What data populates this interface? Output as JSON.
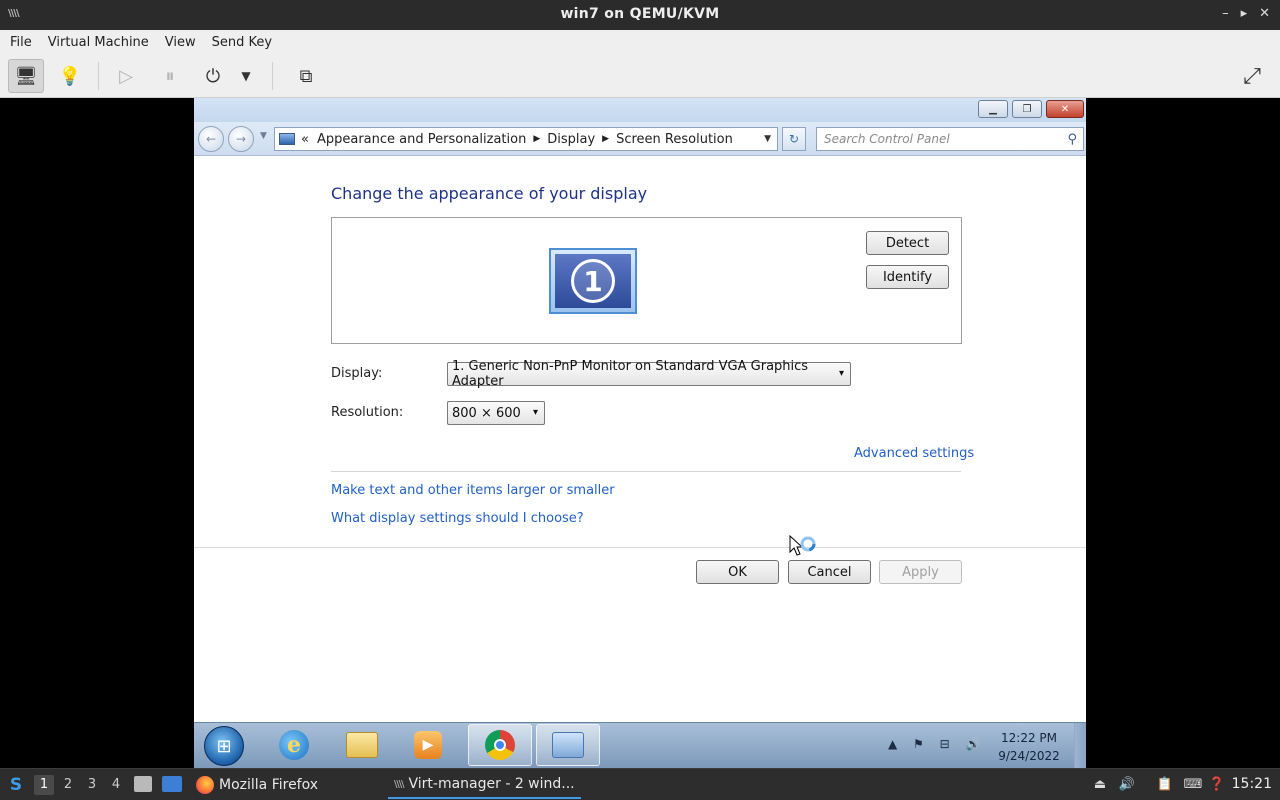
{
  "host": {
    "app_logo": "\\\\\\\\",
    "window_title": "win7 on QEMU/KVM",
    "window_controls": [
      "–",
      "▸",
      "✕"
    ],
    "menu": [
      "File",
      "Virtual Machine",
      "View",
      "Send Key"
    ],
    "toolbar": {
      "console_icon": "🖥",
      "details_icon": "💡",
      "run_icon": "▷",
      "pause_icon": "⏸",
      "power_icon": "⏻",
      "power_menu_icon": "▼",
      "screenshot_icon": "⧉",
      "fullscreen_icon": "⤢"
    }
  },
  "guest": {
    "caption_buttons": {
      "minimize": "▁",
      "maximize": "❐",
      "close": "✕"
    },
    "address": {
      "back_icon": "←",
      "forward_icon": "→",
      "history_icon": "▼",
      "prefix": "«",
      "crumbs": [
        "Appearance and Personalization",
        "Display",
        "Screen Resolution"
      ],
      "arrow": "▶",
      "dropdown_icon": "▼",
      "refresh_icon": "↻",
      "search_placeholder": "Search Control Panel",
      "search_icon": "⚲"
    },
    "title": "Change the appearance of your display",
    "monitor_number": "1",
    "detect_label": "Detect",
    "identify_label": "Identify",
    "display_label": "Display:",
    "display_value": "1. Generic Non-PnP Monitor on Standard VGA Graphics Adapter",
    "resolution_label": "Resolution:",
    "resolution_value": "800 × 600",
    "combo_caret": "▾",
    "advanced_link": "Advanced settings",
    "link_text_size": "Make text and other items larger or smaller",
    "link_help": "What display settings should I choose?",
    "ok_label": "OK",
    "cancel_label": "Cancel",
    "apply_label": "Apply",
    "taskbar": {
      "start_icon": "⊞",
      "media_icon": "▶",
      "tray_icons": "▲ ⚑ ⊟ 🔊",
      "time": "12:22 PM",
      "date": "9/24/2022"
    }
  },
  "panel": {
    "start_icon": "S",
    "desktops": [
      "1",
      "2",
      "3",
      "4"
    ],
    "active_desktop": "1",
    "tasks": [
      {
        "label": "Mozilla Firefox"
      },
      {
        "label": "Virt-manager - 2 wind..."
      }
    ],
    "tray_icons": [
      "⏏",
      "🔊",
      "📋",
      "⌨",
      "❓"
    ],
    "time": "15:21"
  }
}
